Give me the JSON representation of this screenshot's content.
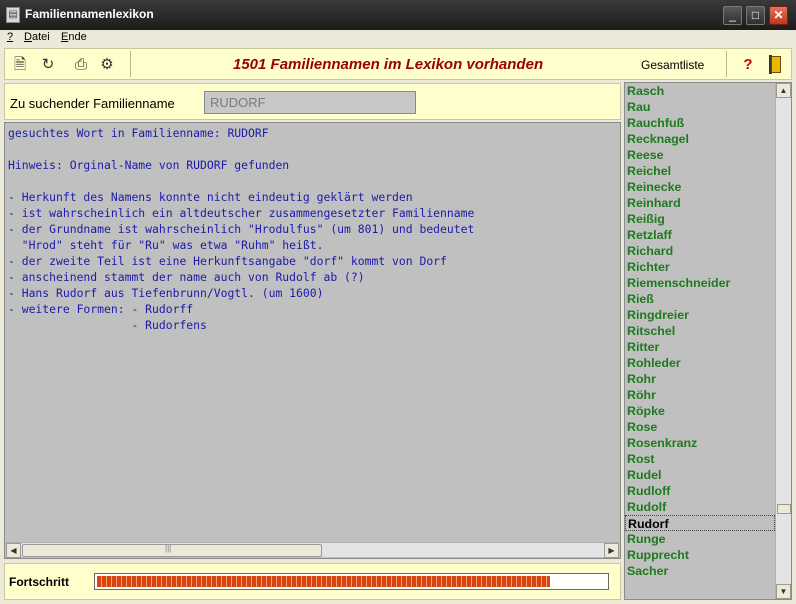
{
  "window": {
    "title": "Familiennamenlexikon"
  },
  "menu": {
    "items": [
      {
        "key": "?",
        "label": ""
      },
      {
        "key": "D",
        "label": "atei"
      },
      {
        "key": "E",
        "label": "nde"
      }
    ]
  },
  "toolbar": {
    "icons": [
      "document-search-icon",
      "refresh-icon",
      "print-icon",
      "settings-icon"
    ],
    "headline": "1501 Familiennamen im Lexikon vorhanden",
    "gesamtliste_label": "Gesamtliste",
    "help_label": "?"
  },
  "search": {
    "label": "Zu suchender Familienname",
    "value": "RUDORF"
  },
  "result": {
    "lines": [
      "gesuchtes Wort in Familienname: RUDORF",
      "",
      "Hinweis: Orginal-Name von RUDORF gefunden",
      "",
      "- Herkunft des Namens konnte nicht eindeutig geklärt werden",
      "- ist wahrscheinlich ein altdeutscher zusammengesetzter Familienname",
      "- der Grundname ist wahrscheinlich \"Hrodulfus\" (um 801) und bedeutet",
      "  \"Hrod\" steht für \"Ru\" was etwa \"Ruhm\" heißt.",
      "- der zweite Teil ist eine Herkunftsangabe \"dorf\" kommt von Dorf",
      "- anscheinend stammt der name auch von Rudolf ab (?)",
      "- Hans Rudorf aus Tiefenbrunn/Vogtl. (um 1600)",
      "- weitere Formen: - Rudorff",
      "                  - Rudorfens"
    ]
  },
  "progress": {
    "label": "Fortschritt",
    "value": 0.89
  },
  "names": {
    "selected": "Rudorf",
    "items": [
      "Rasch",
      "Rau",
      "Rauchfuß",
      "Recknagel",
      "Reese",
      "Reichel",
      "Reinecke",
      "Reinhard",
      "Reißig",
      "Retzlaff",
      "Richard",
      "Richter",
      "Riemenschneider",
      "Rieß",
      "Ringdreier",
      "Ritschel",
      "Ritter",
      "Rohleder",
      "Rohr",
      "Röhr",
      "Röpke",
      "Rose",
      "Rosenkranz",
      "Rost",
      "Rudel",
      "Rudloff",
      "Rudolf",
      "Rudorf",
      "Runge",
      "Rupprecht",
      "Sacher"
    ]
  },
  "colors": {
    "accent_headline": "#990000",
    "name_green": "#1e7a1e",
    "text_blue": "#1b1ba8",
    "panel_yellow": "#ffffcc",
    "progress_orange": "#d94510"
  }
}
